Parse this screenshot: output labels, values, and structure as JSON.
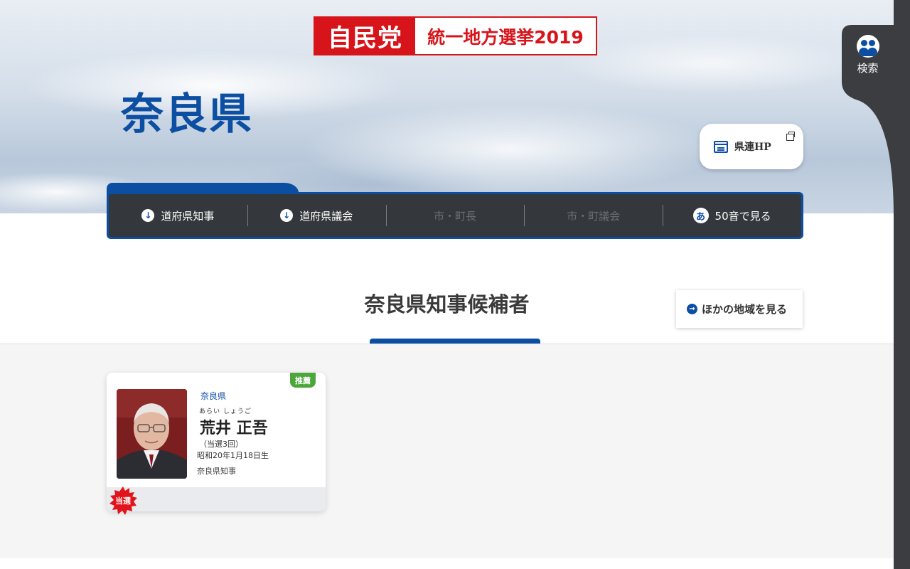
{
  "header": {
    "logo_party": "自民党",
    "logo_election": "統一地方選挙2019",
    "prefecture_title": "奈良県",
    "kenren_link_label": "県連HP"
  },
  "side": {
    "search_label": "検索"
  },
  "nav": {
    "items": [
      {
        "label": "道府県知事",
        "icon": "arrow-down-circle-icon",
        "enabled": true
      },
      {
        "label": "道府県議会",
        "icon": "arrow-down-circle-icon",
        "enabled": true
      },
      {
        "label": "市・町長",
        "enabled": false
      },
      {
        "label": "市・町議会",
        "enabled": false
      },
      {
        "label": "50音で見る",
        "icon": "hiragana-a-icon",
        "icon_glyph": "あ",
        "enabled": true
      }
    ]
  },
  "section": {
    "title": "奈良県知事候補者",
    "other_region_label": "ほかの地域を見る"
  },
  "candidate": {
    "badge": "推薦",
    "prefecture": "奈良県",
    "kana": "あらい しょうご",
    "name": "荒井 正吾",
    "terms": "（当選3回）",
    "birth": "昭和20年1月18日生",
    "position": "奈良県知事",
    "result_badge": "当選"
  },
  "colors": {
    "brand_blue": "#0c4ea2",
    "party_red": "#d7141a",
    "nav_dark": "#34373b",
    "recommend_green": "#4ca63a"
  }
}
